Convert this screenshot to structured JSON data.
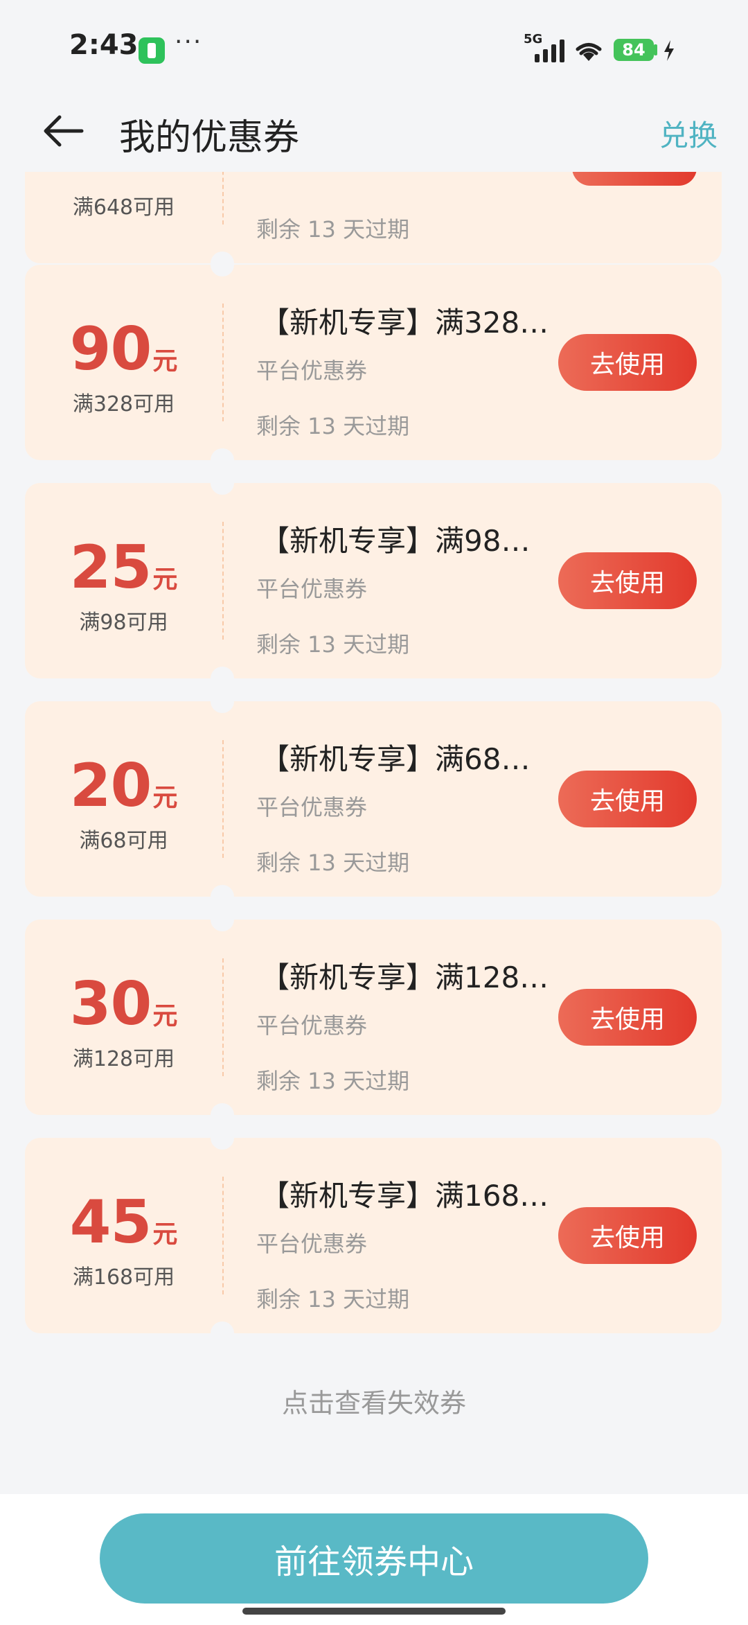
{
  "status_bar": {
    "time": "2:43",
    "more": "···",
    "network": "5G",
    "battery": "84"
  },
  "header": {
    "title": "我的优惠券",
    "exchange": "兑换"
  },
  "partial_coupon": {
    "condition": "满648可用",
    "expiry": "剩余 13 天过期"
  },
  "coupons": [
    {
      "amount": "90",
      "unit": "元",
      "condition": "满328可用",
      "title": "【新机专享】满328…",
      "type": "平台优惠券",
      "expiry": "剩余 13 天过期",
      "button": "去使用"
    },
    {
      "amount": "25",
      "unit": "元",
      "condition": "满98可用",
      "title": "【新机专享】满98…",
      "type": "平台优惠券",
      "expiry": "剩余 13 天过期",
      "button": "去使用"
    },
    {
      "amount": "20",
      "unit": "元",
      "condition": "满68可用",
      "title": "【新机专享】满68…",
      "type": "平台优惠券",
      "expiry": "剩余 13 天过期",
      "button": "去使用"
    },
    {
      "amount": "30",
      "unit": "元",
      "condition": "满128可用",
      "title": "【新机专享】满128…",
      "type": "平台优惠券",
      "expiry": "剩余 13 天过期",
      "button": "去使用"
    },
    {
      "amount": "45",
      "unit": "元",
      "condition": "满168可用",
      "title": "【新机专享】满168…",
      "type": "平台优惠券",
      "expiry": "剩余 13 天过期",
      "button": "去使用"
    }
  ],
  "view_expired": "点击查看失效券",
  "bottom": {
    "coupon_center": "前往领券中心"
  },
  "colors": {
    "accent_teal": "#59b9c6",
    "coupon_red": "#d94a3f",
    "coupon_bg": "#fef0e4"
  }
}
